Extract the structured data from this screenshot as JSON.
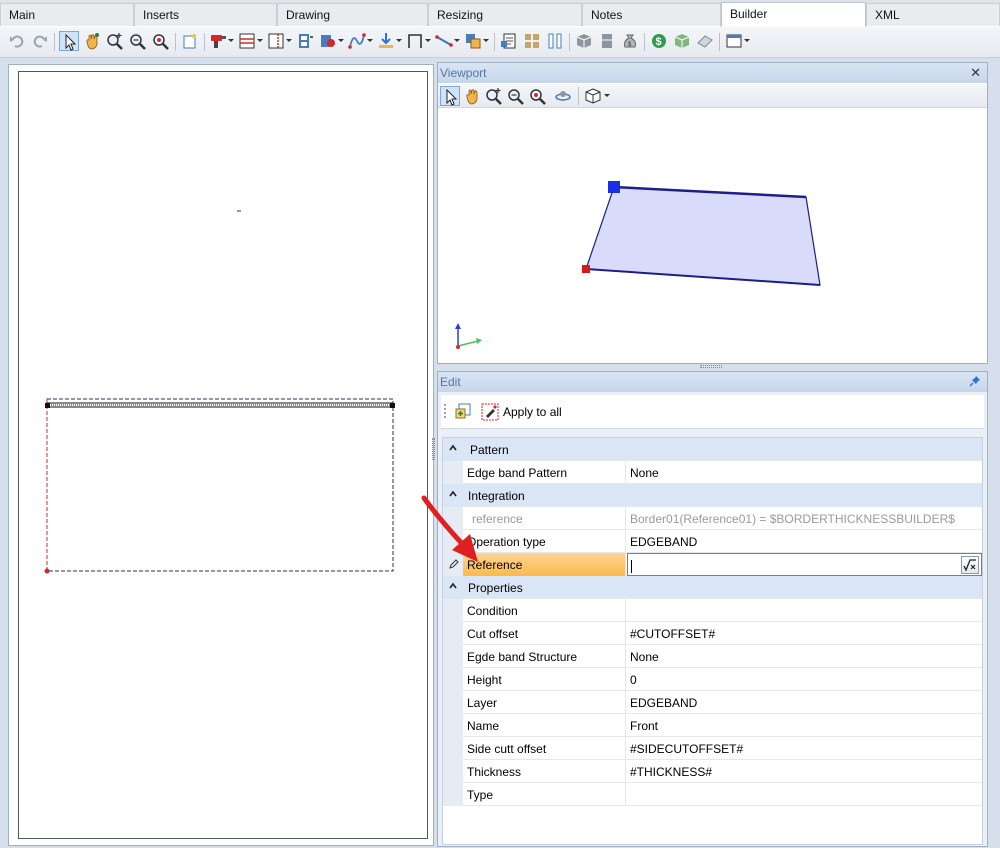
{
  "tabs": [
    {
      "label": "Main",
      "active": false
    },
    {
      "label": "Inserts",
      "active": false
    },
    {
      "label": "Drawing",
      "active": false
    },
    {
      "label": "Resizing",
      "active": false
    },
    {
      "label": "Notes",
      "active": false
    },
    {
      "label": "Builder",
      "active": true
    },
    {
      "label": "XML",
      "active": false
    }
  ],
  "viewport": {
    "title": "Viewport",
    "close_label": "✕"
  },
  "edit": {
    "title": "Edit",
    "apply_all_label": "Apply to all"
  },
  "grid": {
    "categories": {
      "pattern": "Pattern",
      "integration": "Integration",
      "properties": "Properties"
    },
    "pattern_rows": [
      {
        "name": "Edge band Pattern",
        "value": "None"
      }
    ],
    "integration_rows": [
      {
        "name": "reference",
        "value": "Border01(Reference01) = $BORDERTHICKNESSBUILDER$",
        "readonly": true
      },
      {
        "name": "Operation type",
        "value": "EDGEBAND"
      },
      {
        "name": "Reference",
        "value": "",
        "editing": true
      }
    ],
    "property_rows": [
      {
        "name": "Condition",
        "value": ""
      },
      {
        "name": "Cut offset",
        "value": "#CUTOFFSET#"
      },
      {
        "name": "Egde band Structure",
        "value": "None"
      },
      {
        "name": "Height",
        "value": "0"
      },
      {
        "name": "Layer",
        "value": "EDGEBAND"
      },
      {
        "name": "Name",
        "value": "Front"
      },
      {
        "name": "Side cutt offset",
        "value": "#SIDECUTOFFSET#"
      },
      {
        "name": "Thickness",
        "value": "#THICKNESS#"
      },
      {
        "name": "Type",
        "value": ""
      }
    ]
  },
  "colors": {
    "accent": "#2f6fd6",
    "selection": "#f9b94d",
    "shape_fill": "#d9dbfa",
    "shape_stroke": "#1c1f8a",
    "handle_blue": "#1a2ee6",
    "handle_red": "#d61a1a",
    "arrow_red": "#e02020"
  }
}
